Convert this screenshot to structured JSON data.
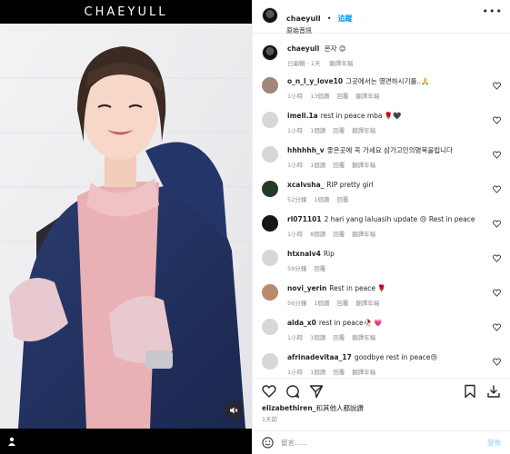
{
  "media": {
    "brand": "CHAEYULL"
  },
  "header": {
    "username": "chaeyull",
    "separator": "•",
    "follow_label": "追蹤",
    "subtitle": "原始音訊",
    "more_label": "•••"
  },
  "caption": {
    "username": "chaeyull",
    "text": "온자 😊",
    "time": "已編輯 · 1天",
    "translate": "翻譯年稿"
  },
  "comments": [
    {
      "username": "o_n_l_y_love10",
      "text": "그곳에서는 영면하시기를..🙏",
      "time": "1小時",
      "likes": "13個讚",
      "reply": "回覆",
      "translate": "翻譯年稿"
    },
    {
      "username": "imell.1a",
      "text": "rest in peace mba 🌹🖤",
      "time": "1小時",
      "likes": "1個讚",
      "reply": "回覆",
      "translate": "翻譯年稿"
    },
    {
      "username": "hhhhhh_v",
      "text": "좋은곳에 꼭 가세요 삼가고인의명복을빕니다",
      "time": "1小時",
      "likes": "1個讚",
      "reply": "回覆",
      "translate": "翻譯年稿"
    },
    {
      "username": "xcalvsha_",
      "text": "RIP pretty girl",
      "time": "52分鐘",
      "likes": "1個讚",
      "reply": "回覆",
      "translate": ""
    },
    {
      "username": "rl071101",
      "text": "2 hari yang laluasih update 😢 Rest in peace",
      "time": "1小時",
      "likes": "8個讚",
      "reply": "回覆",
      "translate": "翻譯年稿"
    },
    {
      "username": "htxnalv4",
      "text": "Rip",
      "time": "59分鐘",
      "likes": "",
      "reply": "回覆",
      "translate": ""
    },
    {
      "username": "novi_yerin",
      "text": "Rest in peace 🌹",
      "time": "56分鐘",
      "likes": "1個讚",
      "reply": "回覆",
      "translate": "翻譯年稿"
    },
    {
      "username": "alda_x0",
      "text": "rest in peace🥀 💗",
      "time": "1小時",
      "likes": "1個讚",
      "reply": "回覆",
      "translate": "翻譯年稿"
    },
    {
      "username": "afrinadevitaa_17",
      "text": "goodbye rest in peace😢",
      "time": "1小時",
      "likes": "1個讚",
      "reply": "回覆",
      "translate": "翻譯年稿"
    }
  ],
  "likes": {
    "name": "elizabethiren_",
    "text": "和其他人都說讚"
  },
  "date": "1天前",
  "composer": {
    "placeholder": "留言......",
    "post_label": "發佈"
  }
}
